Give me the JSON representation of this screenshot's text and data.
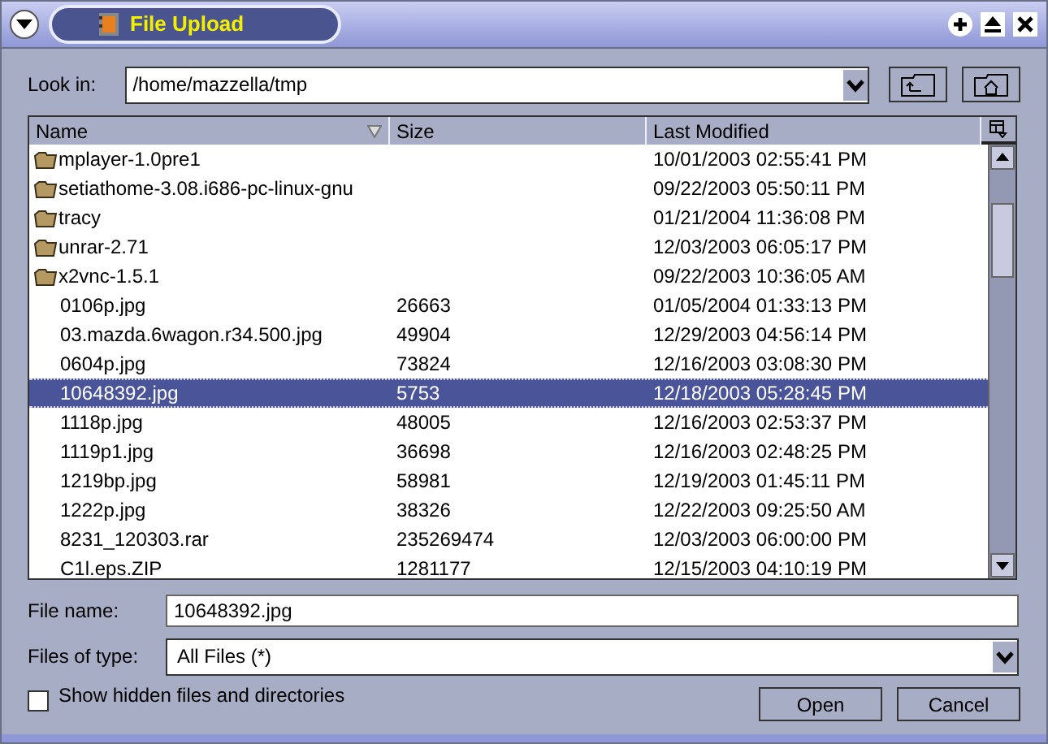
{
  "window": {
    "title": "File Upload"
  },
  "look_in": {
    "label": "Look in:",
    "value": "/home/mazzella/tmp"
  },
  "table": {
    "columns": [
      {
        "label": "Name",
        "sorted": true
      },
      {
        "label": "Size",
        "sorted": false
      },
      {
        "label": "Last Modified",
        "sorted": false
      }
    ],
    "rows": [
      {
        "kind": "folder",
        "name": "mplayer-1.0pre1",
        "size": "",
        "modified": "10/01/2003 02:55:41 PM",
        "selected": false
      },
      {
        "kind": "folder",
        "name": "setiathome-3.08.i686-pc-linux-gnu",
        "size": "",
        "modified": "09/22/2003 05:50:11 PM",
        "selected": false
      },
      {
        "kind": "folder",
        "name": "tracy",
        "size": "",
        "modified": "01/21/2004 11:36:08 PM",
        "selected": false
      },
      {
        "kind": "folder",
        "name": "unrar-2.71",
        "size": "",
        "modified": "12/03/2003 06:05:17 PM",
        "selected": false
      },
      {
        "kind": "folder",
        "name": "x2vnc-1.5.1",
        "size": "",
        "modified": "09/22/2003 10:36:05 AM",
        "selected": false
      },
      {
        "kind": "file",
        "name": "0106p.jpg",
        "size": "26663",
        "modified": "01/05/2004 01:33:13 PM",
        "selected": false
      },
      {
        "kind": "file",
        "name": "03.mazda.6wagon.r34.500.jpg",
        "size": "49904",
        "modified": "12/29/2003 04:56:14 PM",
        "selected": false
      },
      {
        "kind": "file",
        "name": "0604p.jpg",
        "size": "73824",
        "modified": "12/16/2003 03:08:30 PM",
        "selected": false
      },
      {
        "kind": "file",
        "name": "10648392.jpg",
        "size": "5753",
        "modified": "12/18/2003 05:28:45 PM",
        "selected": true
      },
      {
        "kind": "file",
        "name": "1118p.jpg",
        "size": "48005",
        "modified": "12/16/2003 02:53:37 PM",
        "selected": false
      },
      {
        "kind": "file",
        "name": "1119p1.jpg",
        "size": "36698",
        "modified": "12/16/2003 02:48:25 PM",
        "selected": false
      },
      {
        "kind": "file",
        "name": "1219bp.jpg",
        "size": "58981",
        "modified": "12/19/2003 01:45:11 PM",
        "selected": false
      },
      {
        "kind": "file",
        "name": "1222p.jpg",
        "size": "38326",
        "modified": "12/22/2003 09:25:50 AM",
        "selected": false
      },
      {
        "kind": "file",
        "name": "8231_120303.rar",
        "size": "235269474",
        "modified": "12/03/2003 06:00:00 PM",
        "selected": false
      },
      {
        "kind": "file",
        "name": "C1l.eps.ZIP",
        "size": "1281177",
        "modified": "12/15/2003 04:10:19 PM",
        "selected": false
      }
    ]
  },
  "file_name": {
    "label": "File name:",
    "value": "10648392.jpg"
  },
  "file_type": {
    "label": "Files of type:",
    "value": "All Files (*)"
  },
  "show_hidden": {
    "label": "Show hidden files and directories",
    "checked": false
  },
  "buttons": [
    "Open",
    "Cancel"
  ]
}
